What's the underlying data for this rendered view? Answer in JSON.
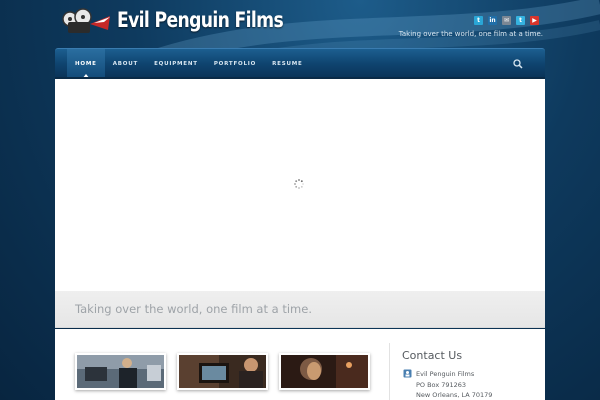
{
  "site": {
    "title": "Evil Penguin Films",
    "tagline": "Taking over the world, one film at a time."
  },
  "social": [
    {
      "icon": "twitter-icon",
      "color": "#2aa6d6",
      "glyph": "t"
    },
    {
      "icon": "linkedin-icon",
      "color": "#1f6ea8",
      "glyph": "in"
    },
    {
      "icon": "email-icon",
      "color": "#7b8794",
      "glyph": "✉"
    },
    {
      "icon": "twitter-bird-icon",
      "color": "#35b3e0",
      "glyph": "t"
    },
    {
      "icon": "youtube-icon",
      "color": "#d8352c",
      "glyph": "▶"
    }
  ],
  "nav": {
    "items": [
      {
        "label": "HOME",
        "active": true
      },
      {
        "label": "ABOUT",
        "active": false
      },
      {
        "label": "EQUIPMENT",
        "active": false
      },
      {
        "label": "PORTFOLIO",
        "active": false
      },
      {
        "label": "RESUME",
        "active": false
      }
    ],
    "search_icon": "search-icon"
  },
  "slider": {
    "status": "loading",
    "spinner_icon": "loading-spinner-icon"
  },
  "tagline_band": {
    "text": "Taking over the world, one film at a time."
  },
  "portfolio_thumbs": [
    {
      "name": "thumb-film-crew-on-street",
      "colors": [
        "#5b6a78",
        "#2c333b",
        "#8e9ba8"
      ]
    },
    {
      "name": "thumb-man-with-monitor",
      "colors": [
        "#3a2a20",
        "#a37a55",
        "#1b1410"
      ]
    },
    {
      "name": "thumb-woman-portrait",
      "colors": [
        "#2b1a14",
        "#7d5a44",
        "#c99a70"
      ]
    }
  ],
  "contact": {
    "title": "Contact Us",
    "address_icon": "address-book-icon",
    "lines": [
      "Evil Penguin Films",
      "PO Box 791263",
      "New Orleans, LA  70179"
    ]
  }
}
